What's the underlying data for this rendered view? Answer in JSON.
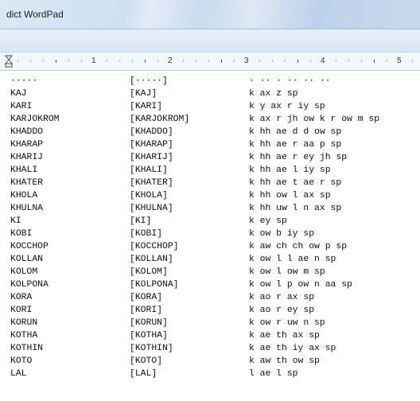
{
  "window": {
    "title": "dict  WordPad"
  },
  "ruler": {
    "numbers": [
      "1",
      "2",
      "3",
      "4",
      "5"
    ]
  },
  "document": {
    "rows": [
      {
        "word": "·····",
        "bracket": "[·····]",
        "phones": "· ·· · ·· ·· ··"
      },
      {
        "word": "KAJ",
        "bracket": "[KAJ]",
        "phones": "k ax z sp"
      },
      {
        "word": "KARI",
        "bracket": "[KARI]",
        "phones": "k y ax r iy sp"
      },
      {
        "word": "KARJOKROM",
        "bracket": "[KARJOKROM]",
        "phones": "k ax r jh ow k r ow m sp"
      },
      {
        "word": "KHADDO",
        "bracket": "[KHADDO]",
        "phones": "k hh ae d d ow sp"
      },
      {
        "word": "KHARAP",
        "bracket": "[KHARAP]",
        "phones": "k hh ae r aa p sp"
      },
      {
        "word": "KHARIJ",
        "bracket": "[KHARIJ]",
        "phones": "k hh ae r ey jh sp"
      },
      {
        "word": "KHALI",
        "bracket": "[KHALI]",
        "phones": "k hh ae l iy sp"
      },
      {
        "word": "KHATER",
        "bracket": "[KHATER]",
        "phones": "k hh ae t ae r sp"
      },
      {
        "word": "KHOLA",
        "bracket": "[KHOLA]",
        "phones": "k hh ow l ax sp"
      },
      {
        "word": "KHULNA",
        "bracket": "[KHULNA]",
        "phones": "k hh uw l n ax sp"
      },
      {
        "word": "KI",
        "bracket": "[KI]",
        "phones": "k ey sp"
      },
      {
        "word": "KOBI",
        "bracket": "[KOBI]",
        "phones": "k ow b iy sp"
      },
      {
        "word": "KOCCHOP",
        "bracket": "[KOCCHOP]",
        "phones": "k aw ch ch ow p sp"
      },
      {
        "word": "KOLLAN",
        "bracket": "[KOLLAN]",
        "phones": "k ow l l ae n sp"
      },
      {
        "word": "KOLOM",
        "bracket": "[KOLOM]",
        "phones": "k ow l ow m sp"
      },
      {
        "word": "KOLPONA",
        "bracket": "[KOLPONA]",
        "phones": "k ow l p ow n aa sp"
      },
      {
        "word": "KORA",
        "bracket": "[KORA]",
        "phones": "k ao r ax sp"
      },
      {
        "word": "KORI",
        "bracket": "[KORI]",
        "phones": "k ao r ey sp"
      },
      {
        "word": "KORUN",
        "bracket": "[KORUN]",
        "phones": "k ow r uw n sp"
      },
      {
        "word": "KOTHA",
        "bracket": "[KOTHA]",
        "phones": "k ae th ax sp"
      },
      {
        "word": "KOTHIN",
        "bracket": "[KOTHIN]",
        "phones": "k ae th iy ax sp"
      },
      {
        "word": "KOTO",
        "bracket": "[KOTO]",
        "phones": "k aw th ow sp"
      },
      {
        "word": "LAL",
        "bracket": "[LAL]",
        "phones": "l ae l sp"
      }
    ]
  }
}
